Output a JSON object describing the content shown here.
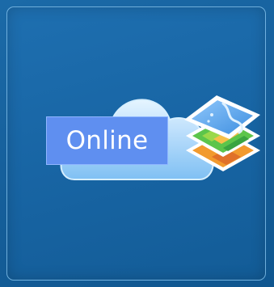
{
  "tile": {
    "label": "Online",
    "icons": [
      "cloud-icon",
      "map-layers-icon"
    ],
    "colors": {
      "background": "#1865a4",
      "border": "#8cc8f0",
      "label_bg": "#5f8ff0",
      "cloud": "#a9d7ff",
      "layer_water": "#5aa9f2",
      "layer_land": "#5cc54b",
      "layer_terrain": "#f29a2e"
    }
  }
}
